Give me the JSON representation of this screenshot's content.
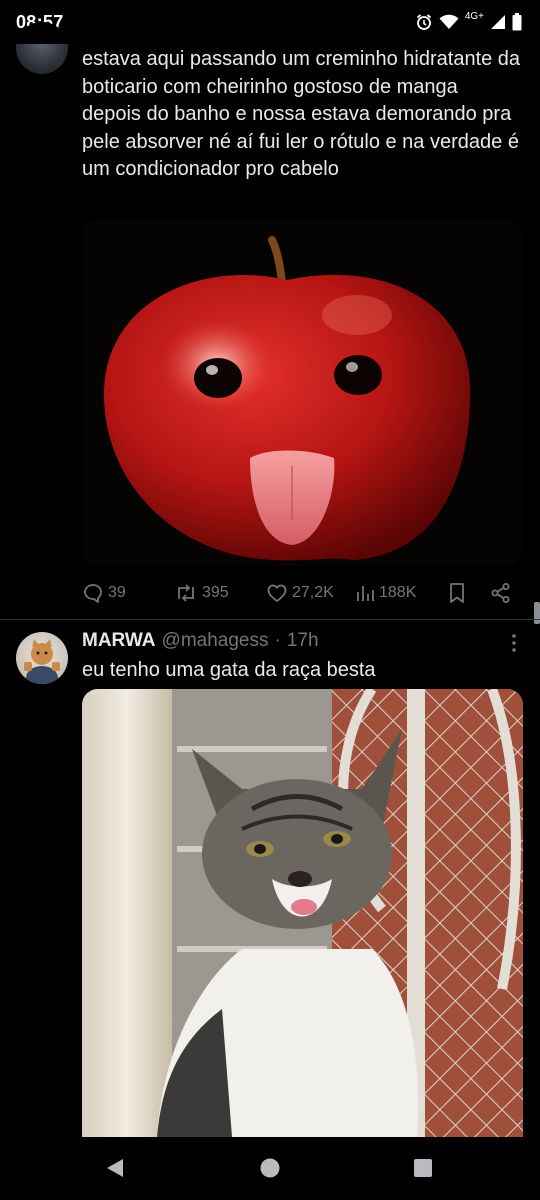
{
  "status_bar": {
    "time": "08:57",
    "network": "4G+",
    "icons": [
      "alarm-icon",
      "wifi-icon",
      "signal-icon",
      "battery-icon"
    ]
  },
  "tweet1": {
    "text": "estava aqui passando um creminho hidratante da boticario com cheirinho gostoso de manga depois do banho e nossa estava demorando pra pele absorver né aí fui ler o rótulo e na verdade é um condicionador pro cabelo",
    "media_description": "red apple with eyes and tongue",
    "actions": {
      "replies": "39",
      "retweets": "395",
      "likes": "27,2K",
      "views": "188K"
    }
  },
  "tweet2": {
    "author_name": "MARWA",
    "handle": "@mahagess",
    "separator": "·",
    "time": "17h",
    "text": "eu tenho uma gata da raça besta",
    "media_description": "tabby and white cat sticking out tongue"
  },
  "nav_bar": {
    "icons": [
      "back-icon",
      "home-icon",
      "recents-icon"
    ]
  },
  "colors": {
    "background": "#000000",
    "text_primary": "#e7e9ea",
    "text_secondary": "#71767b",
    "divider": "#2f3336"
  }
}
